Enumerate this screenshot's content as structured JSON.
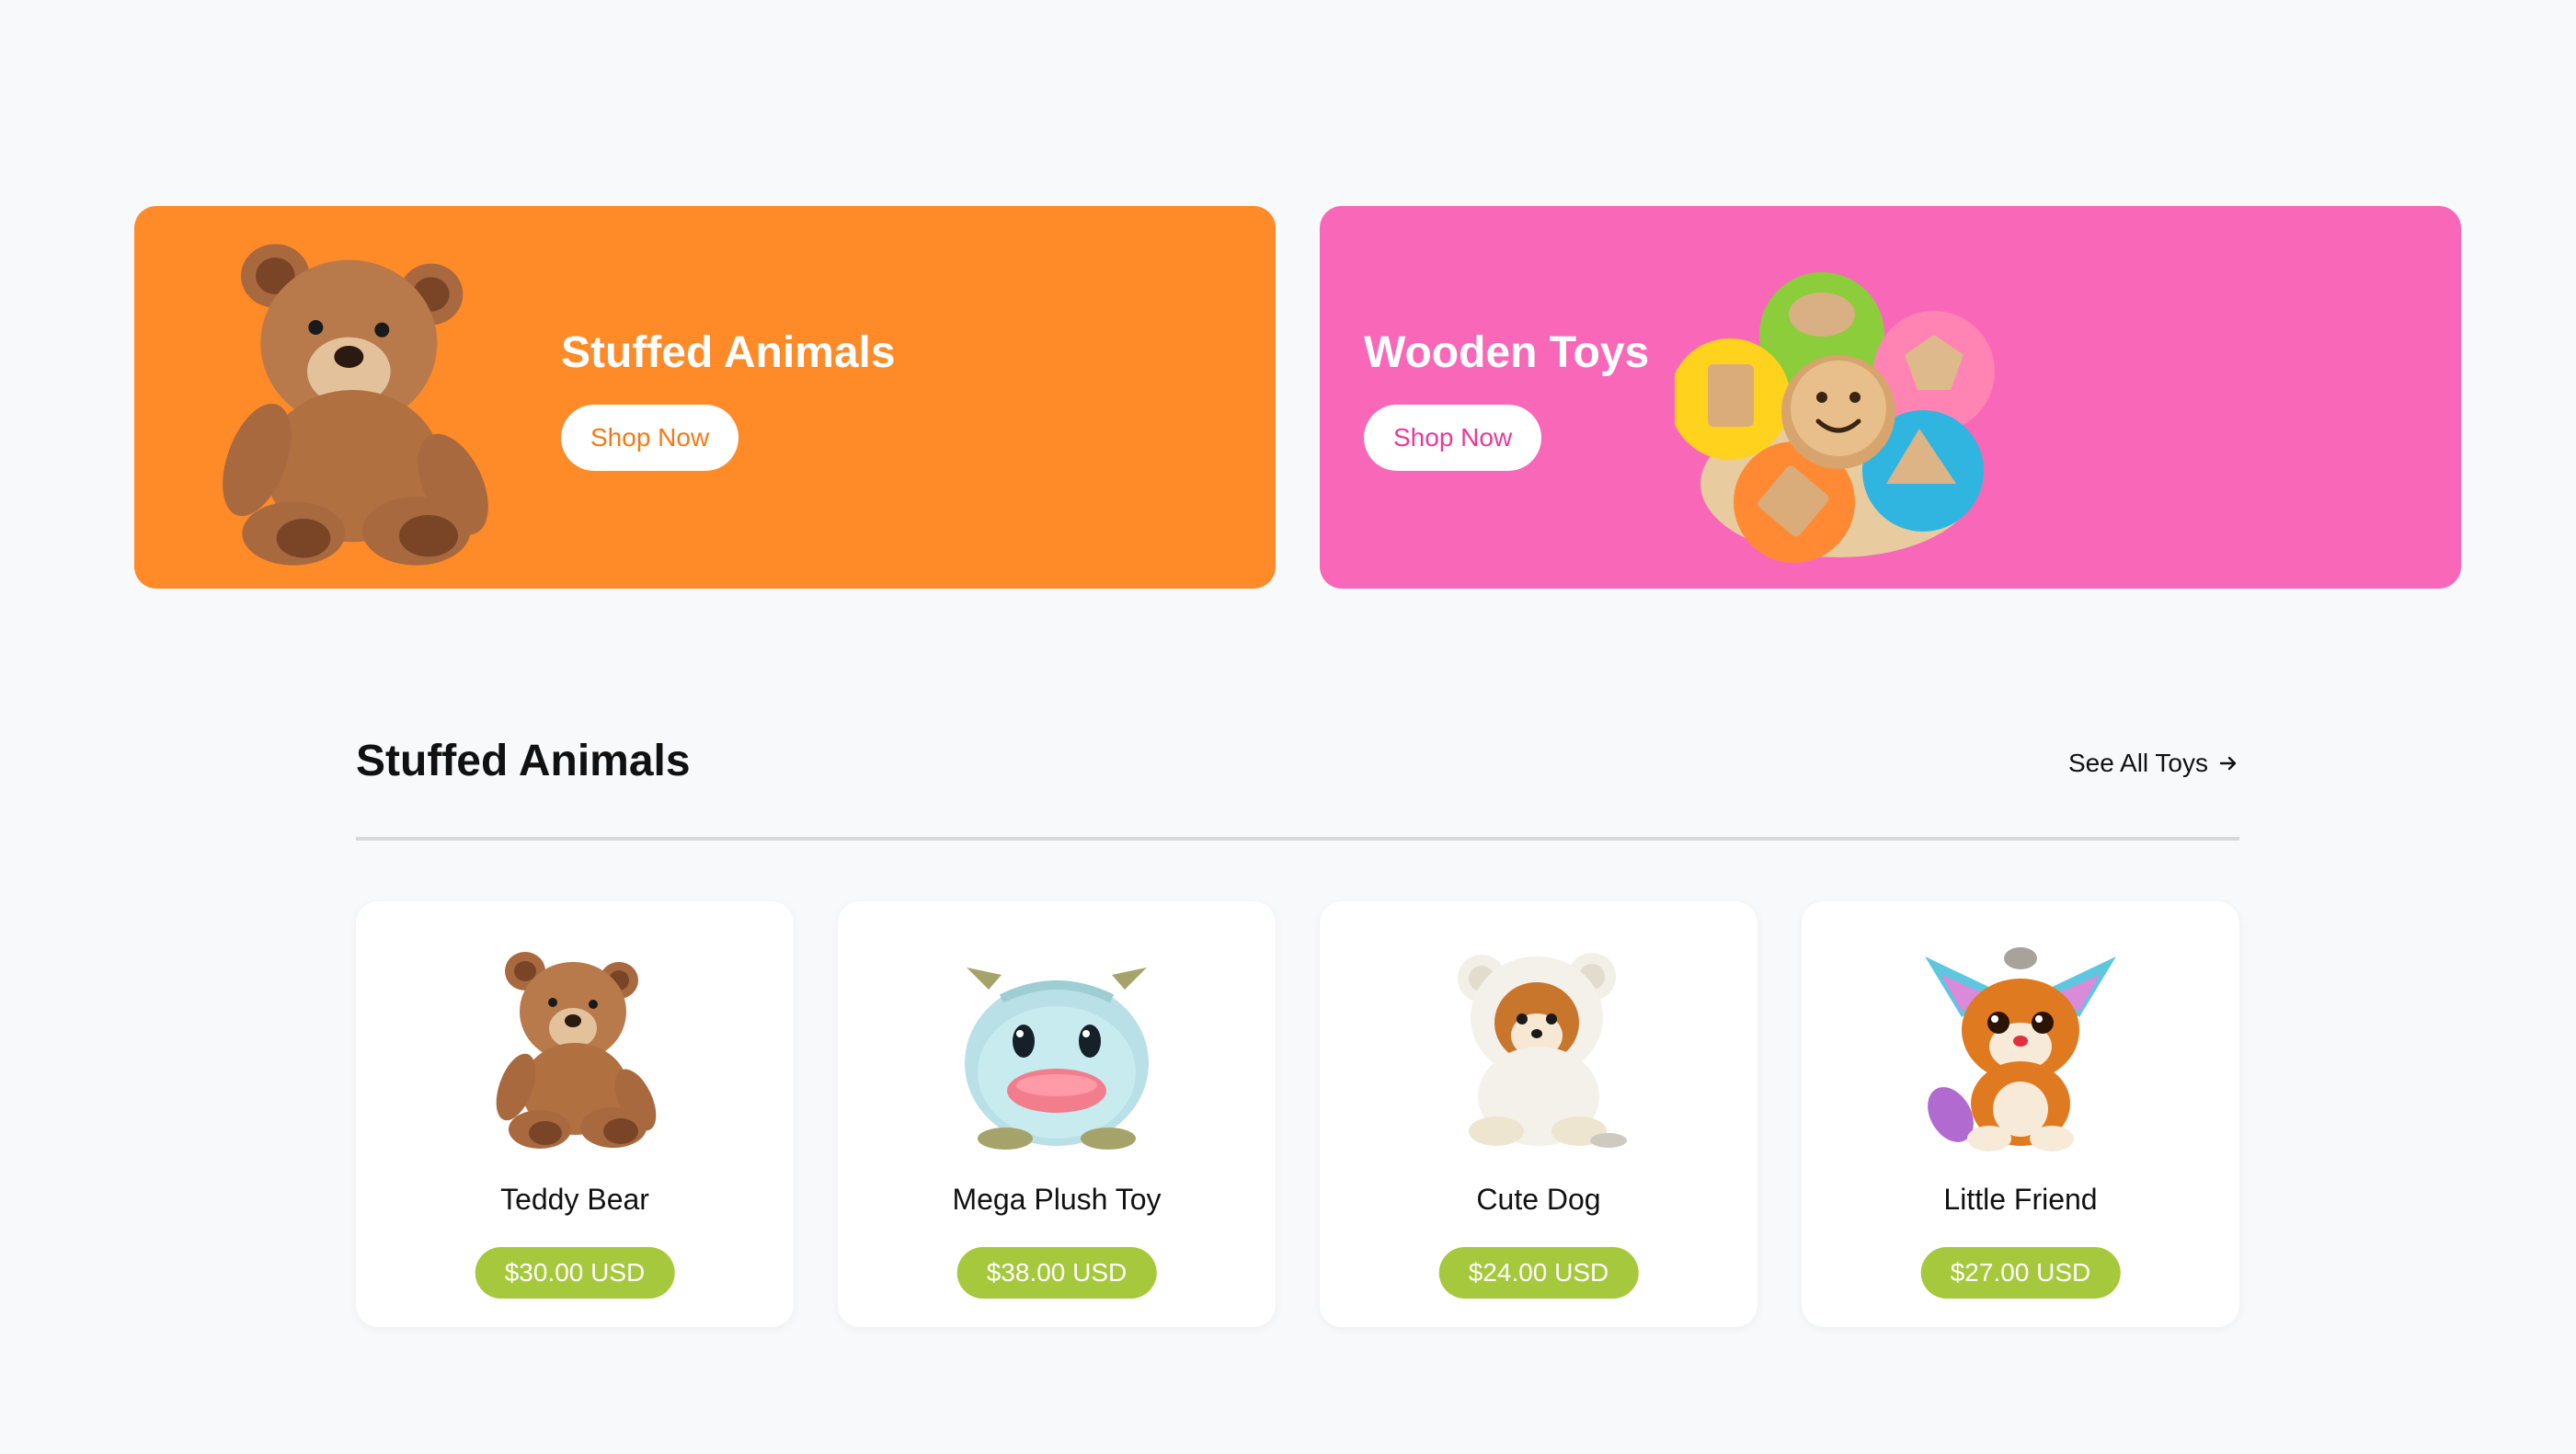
{
  "banners": [
    {
      "title": "Stuffed Animals",
      "button_label": "Shop Now",
      "background": "#ff8a28",
      "button_text_color": "#f47a17",
      "image": "teddy-bear-image"
    },
    {
      "title": "Wooden Toys",
      "button_label": "Shop Now",
      "background": "#f968b8",
      "button_text_color": "#e93a9a",
      "image": "wooden-shape-sorter-image"
    }
  ],
  "section": {
    "title": "Stuffed Animals",
    "see_all_label": "See All Toys",
    "see_all_icon": "arrow-right-icon"
  },
  "products": [
    {
      "name": "Teddy Bear",
      "price": "$30.00 USD",
      "image": "teddy-bear-image"
    },
    {
      "name": "Mega Plush Toy",
      "price": "$38.00 USD",
      "image": "plush-monster-image"
    },
    {
      "name": "Cute Dog",
      "price": "$24.00 USD",
      "image": "plush-dog-image"
    },
    {
      "name": "Little Friend",
      "price": "$27.00 USD",
      "image": "plush-fox-image"
    }
  ],
  "colors": {
    "page_background": "#f8f9fb",
    "price_badge": "#a6c83c",
    "divider": "#d7d9dd"
  }
}
